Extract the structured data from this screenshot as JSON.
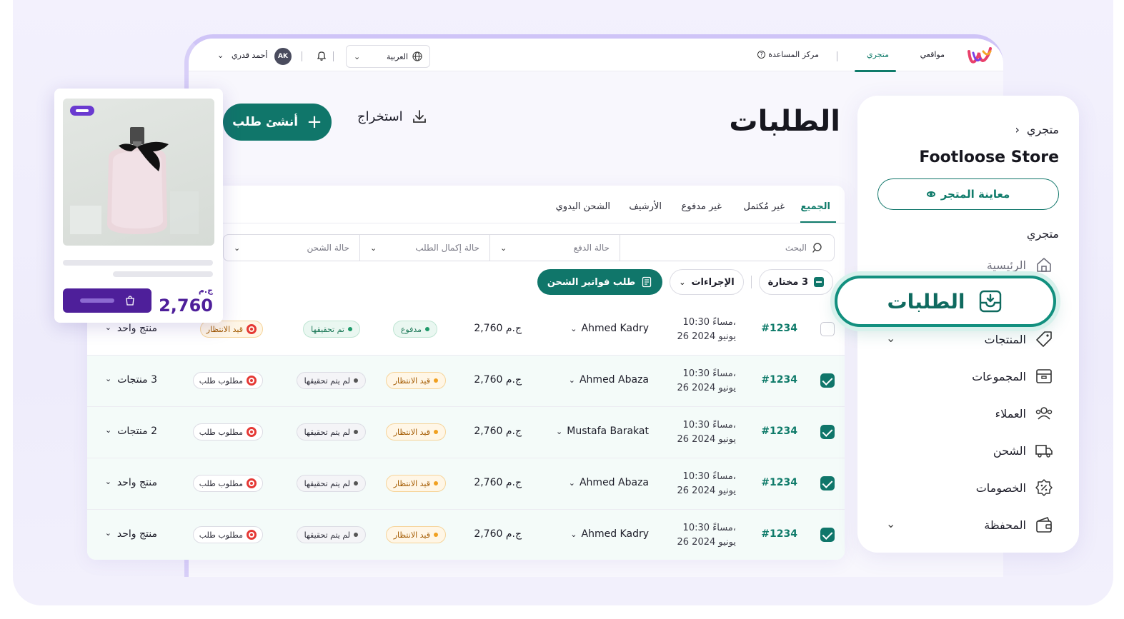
{
  "topbar": {
    "nav": [
      {
        "label": "مواقعي"
      },
      {
        "label": "متجري",
        "active": true
      }
    ],
    "help_label": "مركز المساعدة",
    "language_label": "العربية",
    "user_name": "أحمد قدري",
    "user_initials": "AK"
  },
  "header": {
    "title": "الطلبات",
    "export_label": "استخراج",
    "create_label": "أنشئ طلب"
  },
  "tabs": [
    {
      "label": "الجميع",
      "active": true
    },
    {
      "label": "غير مُكتمل"
    },
    {
      "label": "غير مدفوع"
    },
    {
      "label": "الأرشيف"
    },
    {
      "label": "الشحن اليدوي"
    }
  ],
  "filters": {
    "search_placeholder": "البحث",
    "payment_status": "حالة الدفع",
    "fulfillment_status": "حالة إكمال الطلب",
    "shipping_status": "حالة الشحن"
  },
  "actions": {
    "selected_label": "3 مختارة",
    "actions_label": "الإجراءات",
    "invoice_label": "طلب فواتير الشحن"
  },
  "orders": [
    {
      "id": "#1234",
      "time": "10:30 مساءً،",
      "date": "26 يونيو 2024",
      "customer": "Ahmed Kadry",
      "price": "2,760 ج.م",
      "payment": "مدفوع",
      "payment_state": "paid",
      "fulfillment": "تم تحقيقها",
      "fulfillment_state": "done",
      "shipping": "قيد الانتظار",
      "shipping_state": "wait",
      "items": "منتج واحد",
      "checked": false
    },
    {
      "id": "#1234",
      "time": "10:30 مساءً،",
      "date": "26 يونيو 2024",
      "customer": "Ahmed Abaza",
      "price": "2,760 ج.م",
      "payment": "قيد الانتظار",
      "payment_state": "wait",
      "fulfillment": "لم يتم تحقيقها",
      "fulfillment_state": "no",
      "shipping": "مطلوب طلب",
      "shipping_state": "req",
      "items": "3 منتجات",
      "checked": true
    },
    {
      "id": "#1234",
      "time": "10:30 مساءً،",
      "date": "26 يونيو 2024",
      "customer": "Mustafa Barakat",
      "price": "2,760 ج.م",
      "payment": "قيد الانتظار",
      "payment_state": "wait",
      "fulfillment": "لم يتم تحقيقها",
      "fulfillment_state": "no",
      "shipping": "مطلوب طلب",
      "shipping_state": "req",
      "items": "2 منتجات",
      "checked": true
    },
    {
      "id": "#1234",
      "time": "10:30 مساءً،",
      "date": "26 يونيو 2024",
      "customer": "Ahmed Abaza",
      "price": "2,760 ج.م",
      "payment": "قيد الانتظار",
      "payment_state": "wait",
      "fulfillment": "لم يتم تحقيقها",
      "fulfillment_state": "no",
      "shipping": "مطلوب طلب",
      "shipping_state": "req",
      "items": "منتج واحد",
      "checked": true
    },
    {
      "id": "#1234",
      "time": "10:30 مساءً،",
      "date": "26 يونيو 2024",
      "customer": "Ahmed Kadry",
      "price": "2,760 ج.م",
      "payment": "قيد الانتظار",
      "payment_state": "wait",
      "fulfillment": "لم يتم تحقيقها",
      "fulfillment_state": "no",
      "shipping": "مطلوب طلب",
      "shipping_state": "req",
      "items": "منتج واحد",
      "checked": true
    }
  ],
  "sidebar": {
    "breadcrumb": "متجري",
    "store_name": "Footloose Store",
    "preview_label": "معاينة المتجر",
    "section_label": "متجري",
    "items": [
      {
        "label": "الرئيسية",
        "icon": "home-icon"
      },
      {
        "label": "الطلبات",
        "icon": "inbox-download-icon",
        "active": true
      },
      {
        "label": "المنتجات",
        "icon": "tag-icon"
      },
      {
        "label": "المجموعات",
        "icon": "box-icon"
      },
      {
        "label": "العملاء",
        "icon": "users-icon"
      },
      {
        "label": "الشحن",
        "icon": "truck-icon"
      },
      {
        "label": "الخصومات",
        "icon": "discount-icon"
      },
      {
        "label": "المحفظة",
        "icon": "wallet-icon"
      }
    ]
  },
  "product_card": {
    "currency": "ج.م",
    "price": "2,760"
  },
  "colors": {
    "primary": "#10766a",
    "accent_purple": "#4e1f9a",
    "success": "#1f9a6a",
    "warning": "#f0a020",
    "danger": "#e53935"
  }
}
